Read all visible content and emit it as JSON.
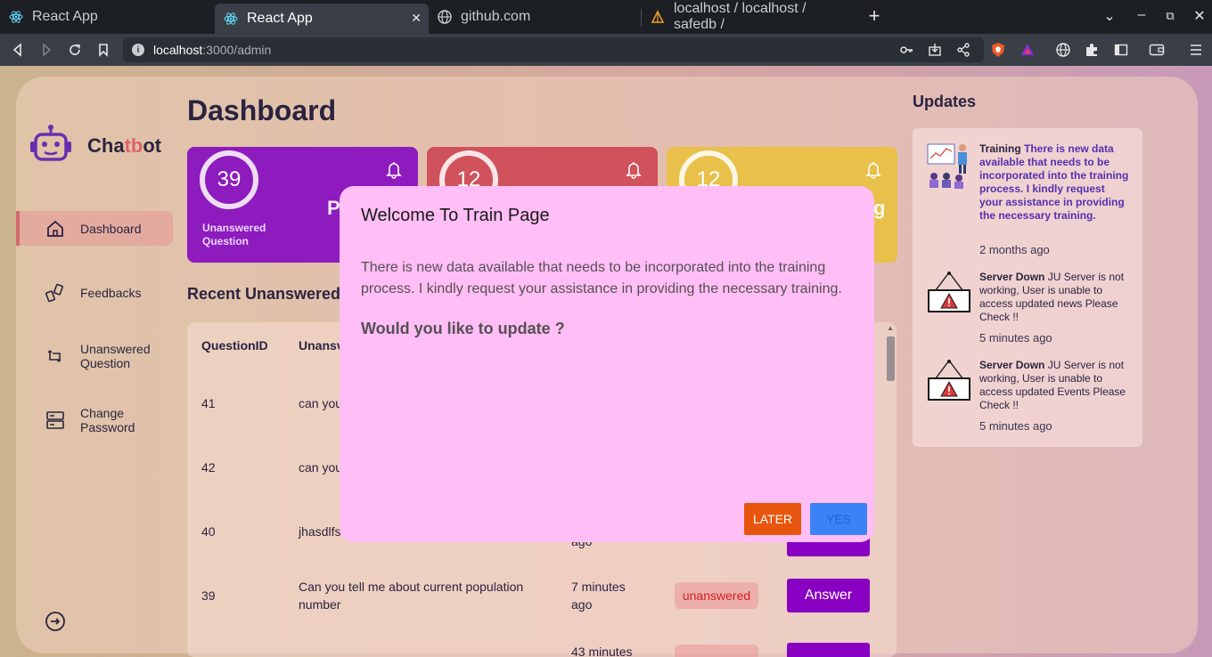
{
  "browser": {
    "tabs": [
      {
        "title": "React App",
        "icon": "react-icon"
      },
      {
        "title": "React App",
        "icon": "react-icon",
        "active": true
      },
      {
        "title": "github.com",
        "icon": "globe-icon"
      },
      {
        "title": "localhost / localhost / safedb /",
        "icon": "phpmyadmin-icon"
      }
    ],
    "url_host": "localhost",
    "url_path": ":3000/admin"
  },
  "sidebar": {
    "brand_prefix": "Cha",
    "brand_accent": "tb",
    "brand_suffix": "ot",
    "items": [
      {
        "label": "Dashboard",
        "icon": "home-icon",
        "active": true
      },
      {
        "label": "Feedbacks",
        "icon": "feedback-icon"
      },
      {
        "label": "Unanswered Question",
        "icon": "question-icon"
      },
      {
        "label": "Change Password",
        "icon": "server-icon"
      }
    ]
  },
  "dashboard": {
    "title": "Dashboard",
    "cards": [
      {
        "count": "39",
        "label_line1": "Unanswered",
        "label_line2": "Question",
        "big": "P",
        "color": "#8e1bbd"
      },
      {
        "count": "12",
        "color": "#d0525c"
      },
      {
        "count": "12",
        "big": "g",
        "color": "#e8c04a"
      }
    ],
    "recent_title": "Recent Unanswered",
    "table": {
      "headers": [
        "QuestionID",
        "Unansv"
      ],
      "rows": [
        {
          "id": "41",
          "question": "can you"
        },
        {
          "id": "42",
          "question": "can you"
        },
        {
          "id": "40",
          "question": "jhasdlfs",
          "time": "ago"
        },
        {
          "id": "39",
          "question_line1": "Can you tell me about current population",
          "question_line2": "number",
          "time_line1": "7 minutes",
          "time_line2": "ago",
          "status": "unanswered",
          "action": "Answer"
        },
        {
          "time_line1": "43 minutes"
        }
      ]
    }
  },
  "updates": {
    "title": "Updates",
    "items": [
      {
        "heading": "Training",
        "text": "There is new data available that needs to be incorporated into the training process. I kindly request your assistance in providing the necessary training.",
        "time": "2 months ago",
        "icon": "training-illustration"
      },
      {
        "heading": "Server Down",
        "text": "JU Server is not working, User is unable to access updated news Please Check !!",
        "time": "5 minutes ago",
        "icon": "warning-sign-icon"
      },
      {
        "heading": "Server Down",
        "text": "JU Server is not working, User is unable to access updated Events Please Check !!",
        "time": "5 minutes ago",
        "icon": "warning-sign-icon"
      }
    ]
  },
  "modal": {
    "title": "Welcome To Train Page",
    "body": "There is new data available that needs to be incorporated into the training process. I kindly request your assistance in providing the necessary training.",
    "question": "Would you like to update ?",
    "later_label": "LATER",
    "yes_label": "YES"
  }
}
